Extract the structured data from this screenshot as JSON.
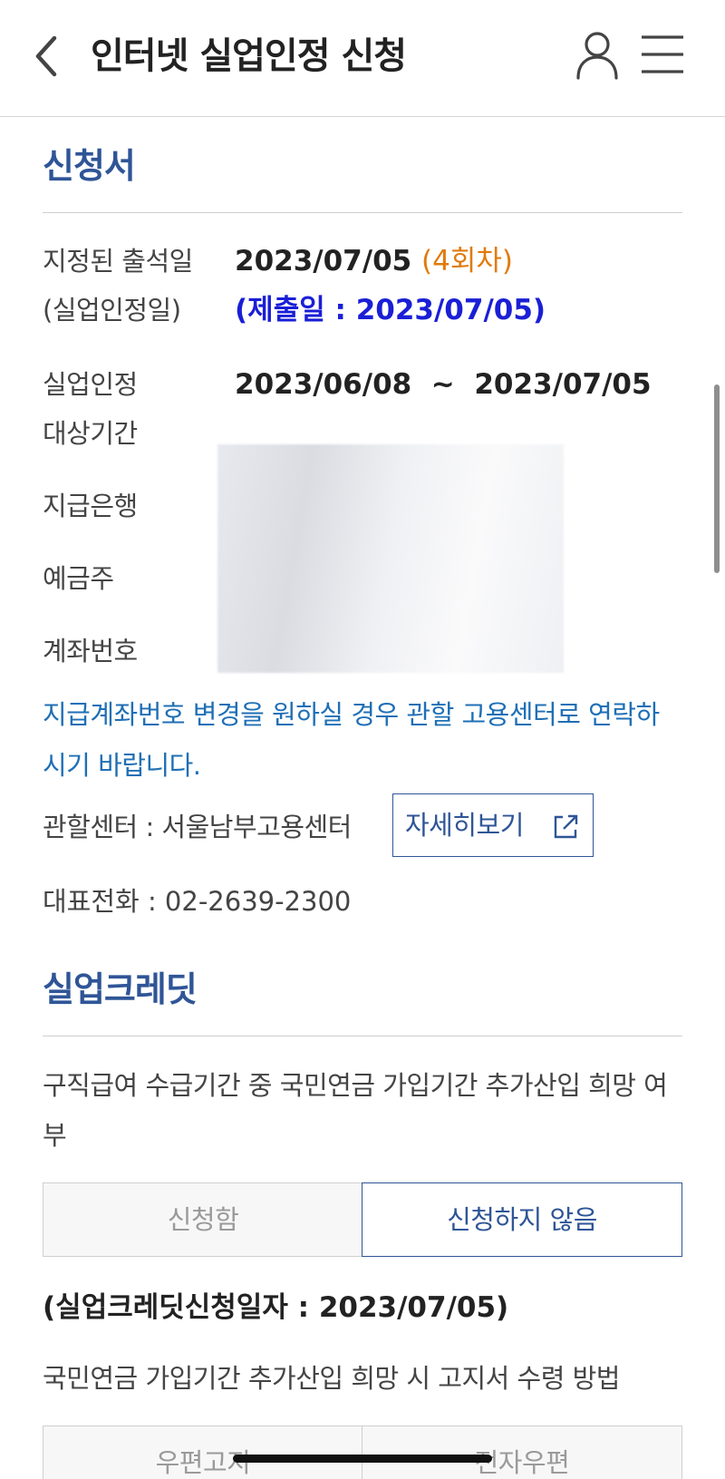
{
  "header": {
    "title": "인터넷 실업인정 신청",
    "back_icon": "chevron-left-icon",
    "user_icon": "user-icon",
    "menu_icon": "hamburger-menu-icon"
  },
  "application": {
    "section_title": "신청서",
    "attendance_label_1": "지정된 출석일",
    "attendance_label_2": "(실업인정일)",
    "attendance_date": "2023/07/05",
    "attendance_round": "(4회차)",
    "submission": "(제출일 : 2023/07/05)",
    "period_label_1": "실업인정",
    "period_label_2": "대상기간",
    "period_value": "2023/06/08  ~  2023/07/05",
    "bank_label": "지급은행",
    "holder_label": "예금주",
    "account_label": "계좌번호",
    "notice": "지급계좌번호 변경을 원하실 경우 관할 고용센터로 연락하시기 바랍니다.",
    "center_label": "관할센터 : 서울남부고용센터",
    "detail_button": "자세히보기",
    "phone": "대표전화 : 02-2639-2300"
  },
  "credit": {
    "section_title": "실업크레딧",
    "question": "구직급여 수급기간 중 국민연금 가입기간 추가산입 희망 여부",
    "option_apply": "신청함",
    "option_not_apply": "신청하지 않음",
    "selected": "신청하지 않음",
    "apply_date": "(실업크레딧신청일자 : 2023/07/05)",
    "method_question": "국민연금 가입기간 추가산입 희망 시 고지서 수령 방법",
    "method_option_1": "우편고지",
    "method_option_2": "전자우편"
  },
  "colors": {
    "accent": "#2f5597",
    "notice_blue": "#1f6fb5",
    "submission_blue": "#1a1fd6",
    "round_orange": "#e07b0c"
  }
}
